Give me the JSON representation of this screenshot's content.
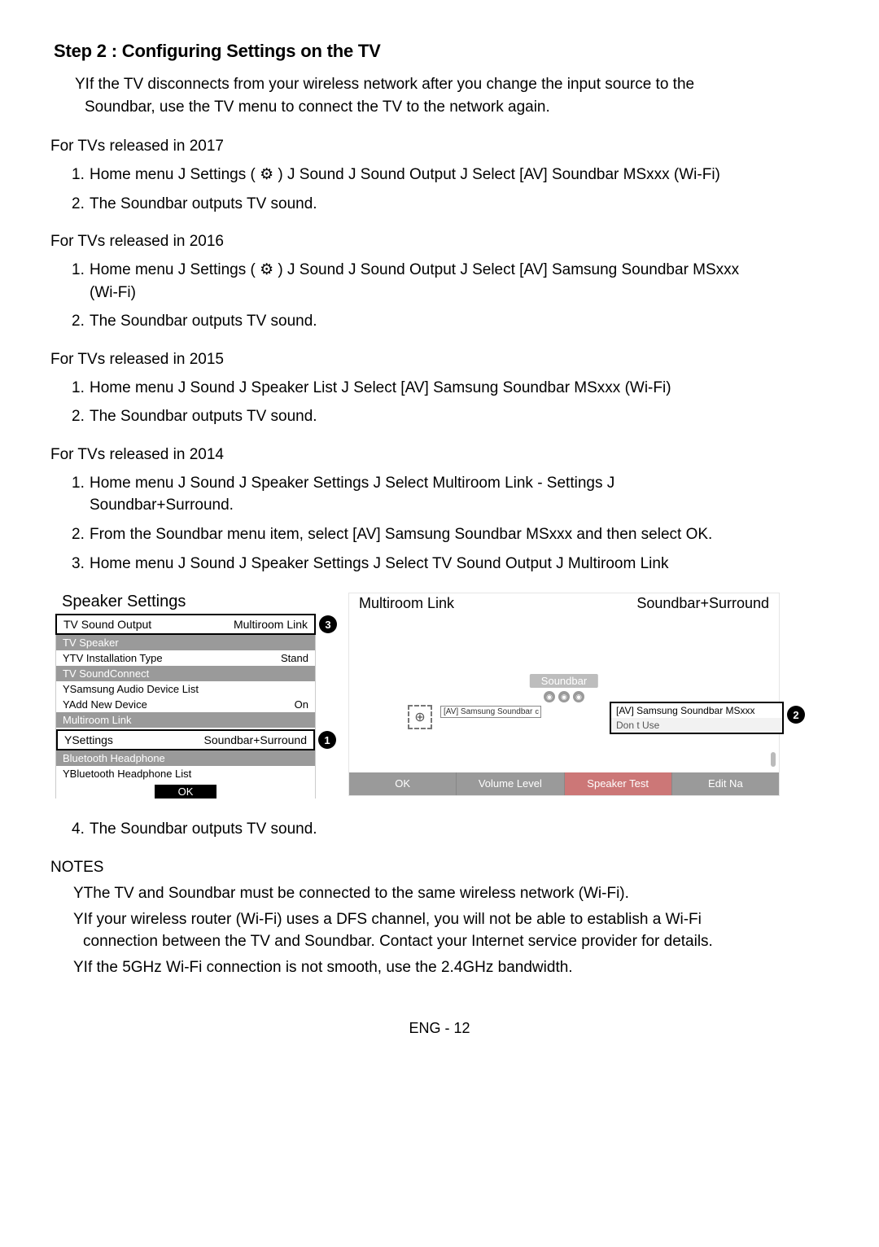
{
  "step_title": "Step 2 : Configuring Settings on the TV",
  "intro_note_line1": "YIf the TV disconnects from your wireless network after you change the input source to the",
  "intro_note_line2": "Soundbar, use the TV menu to connect the TV to the network again.",
  "gear_glyph": "⚙",
  "arrow": " J ",
  "sections": {
    "y2017": {
      "title": "For TVs released in 2017",
      "items": [
        "Home menu J Settings ( ⚙ ) J Sound J Sound Output J Select [AV] Soundbar MSxxx (Wi-Fi)",
        "The Soundbar outputs TV sound."
      ]
    },
    "y2016": {
      "title": "For TVs released in 2016",
      "items_line1": "Home menu J Settings ( ⚙ ) J Sound J Sound Output J Select [AV] Samsung Soundbar MSxxx",
      "items_line2": "(Wi-Fi)",
      "item2": "The Soundbar outputs TV sound."
    },
    "y2015": {
      "title": "For TVs released in 2015",
      "items": [
        "Home menu J Sound J Speaker List J Select [AV] Samsung Soundbar MSxxx (Wi-Fi)",
        "The Soundbar outputs TV sound."
      ]
    },
    "y2014": {
      "title": "For TVs released in 2014",
      "i1_l1": "Home menu J Sound J Speaker Settings J Select Multiroom Link - Settings  J",
      "i1_l2": "Soundbar+Surround.",
      "i2": "From the Soundbar menu item, select [AV] Samsung Soundbar MSxxx and then select  OK.",
      "i3": "Home menu J Sound J Speaker Settings J Select TV Sound Output J Multiroom Link",
      "i4": "The Soundbar outputs TV sound."
    }
  },
  "panel_left": {
    "title": "Speaker Settings",
    "top_left": "TV Sound Output",
    "top_right": "Multiroom Link",
    "callout_top": "3",
    "cat1": "TV Speaker",
    "row1_l": "YTV Installation Type",
    "row1_r": "Stand",
    "cat2": "TV SoundConnect",
    "row2": "YSamsung Audio Device List",
    "row3_l": "YAdd New Device",
    "row3_r": "On",
    "cat3": "Multiroom Link",
    "row4_l": "YSettings",
    "row4_r": "Soundbar+Surround",
    "callout_mid": "1",
    "cat4": "Bluetooth Headphone",
    "row5": "YBluetooth Headphone List",
    "ok": "OK"
  },
  "panel_right": {
    "hl": "Multiroom Link",
    "hr": "Soundbar+Surround",
    "soundbar": "Soundbar",
    "plus": "⊕",
    "small_label": "[AV] Samsung Soundbar",
    "small_c": "c",
    "dd1": "[AV] Samsung Soundbar MSxxx",
    "dd2": "Don t Use",
    "callout": "2",
    "f_ok": "OK",
    "f_vol": "Volume Level",
    "f_st": "Speaker Test",
    "f_edit": "Edit Na"
  },
  "notes_title": "NOTES",
  "notes": {
    "n1": "YThe TV and Soundbar must be connected to the same wireless network (Wi-Fi).",
    "n2_l1": "YIf your wireless router (Wi-Fi) uses a DFS channel, you will not be able to establish a Wi-Fi",
    "n2_l2": "connection between the TV and Soundbar. Contact your Internet service provider for details.",
    "n3": "YIf the 5GHz Wi-Fi connection is not smooth, use the 2.4GHz bandwidth."
  },
  "footer": "ENG - 12"
}
